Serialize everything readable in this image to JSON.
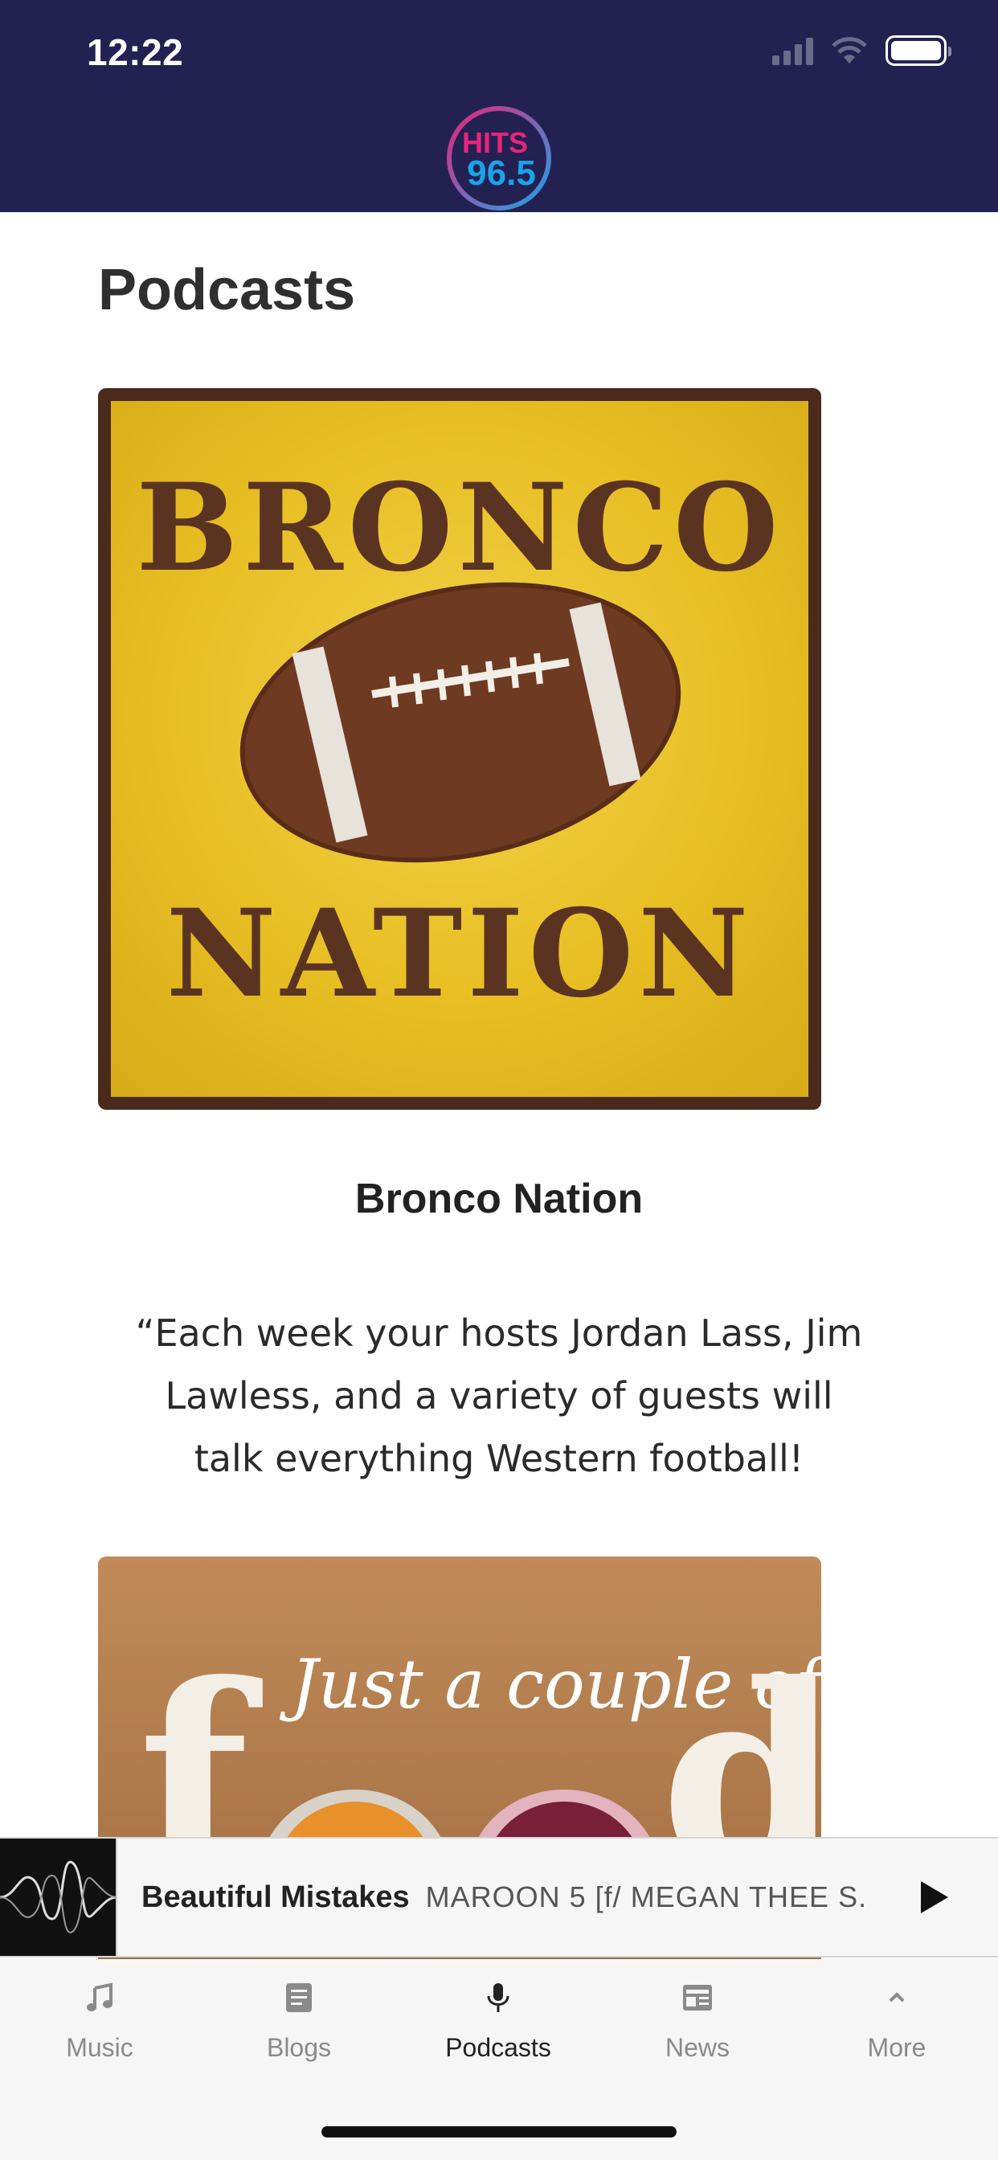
{
  "status_bar": {
    "time": "12:22"
  },
  "header": {
    "logo_text_top": "HITS",
    "logo_text_bottom": "96.5"
  },
  "page": {
    "title": "Podcasts"
  },
  "podcasts": [
    {
      "art_words": [
        "BRONCO",
        "NATION"
      ],
      "name": "Bronco Nation",
      "description": "“Each week your hosts Jordan Lass, Jim Lawless, and a variety of guests will talk everything Western football!"
    },
    {
      "art_script": "Just a couple of",
      "art_big_left": "f",
      "art_big_right": "d"
    }
  ],
  "now_playing": {
    "title": "Beautiful Mistakes",
    "artist": "MAROON 5 [f/ MEGAN THEE S..."
  },
  "tabs": [
    {
      "label": "Music",
      "icon": "music-note-icon"
    },
    {
      "label": "Blogs",
      "icon": "document-icon"
    },
    {
      "label": "Podcasts",
      "icon": "microphone-icon",
      "active": true
    },
    {
      "label": "News",
      "icon": "newspaper-icon"
    },
    {
      "label": "More",
      "icon": "chevron-up-icon"
    }
  ],
  "colors": {
    "header_bg": "#232152",
    "accent_pink": "#e8247a",
    "accent_blue": "#1aa3e8"
  }
}
